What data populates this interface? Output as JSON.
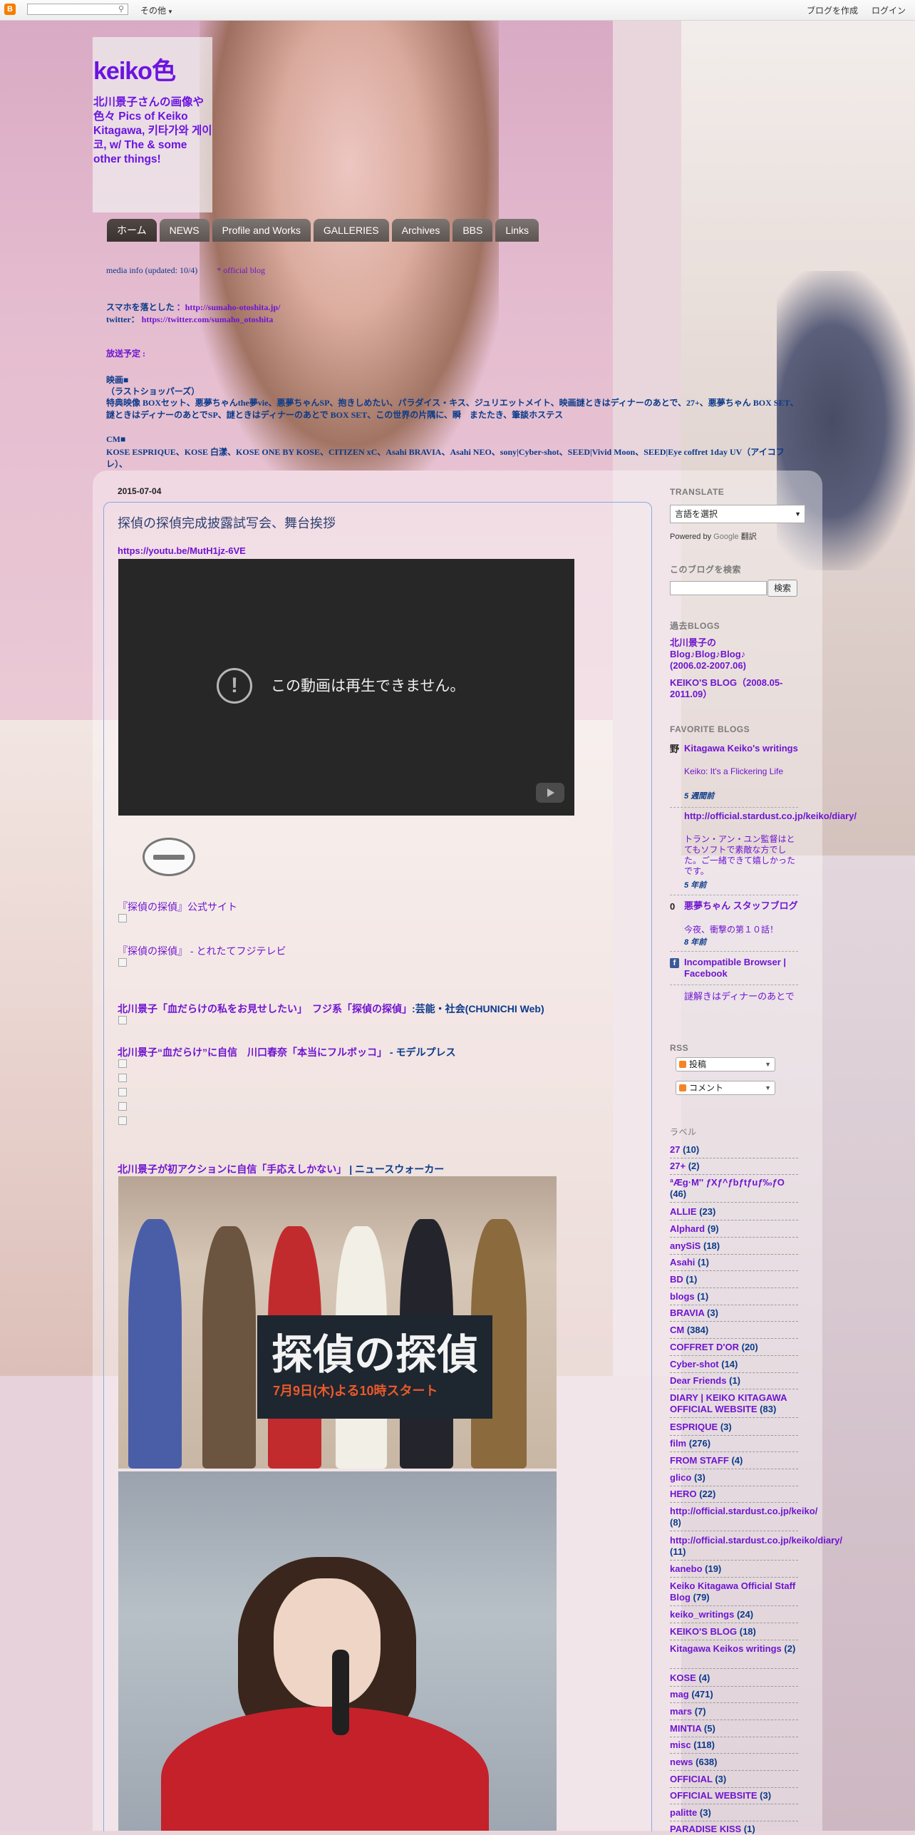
{
  "navbar": {
    "logo": "B",
    "more_label": "その他",
    "create_blog": "ブログを作成",
    "login": "ログイン"
  },
  "header": {
    "title": "keiko色",
    "description": "北川景子さんの画像や色々 Pics of Keiko Kitagawa, 키타가와 게이코, w/ The & some other things!",
    "tabs": [
      "ホーム",
      "NEWS",
      "Profile and Works",
      "GALLERIES",
      "Archives",
      "BBS",
      "Links"
    ],
    "line1_prefix": "media info (updated: 10/4)",
    "line1_link": "* official blog",
    "line2_label": "スマホを落とした",
    "line2_link": "：http://sumaho-otoshita.jp/",
    "line3_label": "twitter：",
    "line3_link": "https://twitter.com/sumaho_otoshita",
    "line4": "放送予定 :",
    "line5": "映画■",
    "line6": "（ラストショッパーズ）",
    "line7": "特典映像 BOXセット、悪夢ちゃんthe夢vie、悪夢ちゃんSP、抱きしめたい、パラダイス・キス、ジュリエットメイト、映画謎ときはディナーのあとで、27+、悪夢ちゃん BOX SET、謎ときはディナーのあとでSP、謎ときはディナーのあとで BOX SET、この世界の片隅に、瞬　またたき、筆談ホステス",
    "line8": "CM■",
    "line9": "KOSE ESPRIQUE、KOSE 白漾、KOSE ONE BY KOSE、CITIZEN xC、Asahi BRAVIA、Asahi NEO、sony|Cyber-shot、SEED|Vivid Moon、SEED|Eye coffret 1day UV（アイコフレ）、"
  },
  "post": {
    "date": "2015-07-04",
    "title": "探偵の探偵完成披露試写会、舞台挨拶",
    "youtube_link": "https://youtu.be/MutH1jz-6VE",
    "video_message": "この動画は再生できません。",
    "warn_icon": "!",
    "links": [
      {
        "text": "『探偵の探偵』公式サイト",
        "tail": ""
      },
      {
        "text": "『探偵の探偵』 - とれたてフジテレビ",
        "tail": ""
      },
      {
        "text": "北川景子「血だらけの私をお見せしたい」　フジ系「探偵の探偵」",
        "tail": ":芸能・社会(CHUNICHI Web)"
      },
      {
        "text": "北川景子“血だらけ”に自信　川口春奈「本当にフルボッコ」",
        "tail": " - モデルプレス"
      },
      {
        "text": "北川景子が初アクションに自信「手応えしかない」",
        "tail": " | ニュースウォーカー"
      }
    ],
    "photo1_banner_title": "探偵の探偵",
    "photo1_banner_sub": "7月9日(木)よる10時スタート"
  },
  "sidebar": {
    "translate_head": "TRANSLATE",
    "translate_select": "言語を選択",
    "powered_by": "Powered by",
    "google": "Google",
    "translate_word": "翻訳",
    "search_head": "このブログを検索",
    "search_button": "検索",
    "past_head": "過去BLOGS",
    "past_links": [
      "北川景子の Blog♪Blog♪Blog♪ (2006.02-2007.06)",
      "KEIKO'S BLOG（2008.05-2011.09）"
    ],
    "fav_head": "FAVORITE BLOGS",
    "favorites": [
      {
        "icon": "野",
        "title": "Kitagawa Keiko's writings",
        "sub": "Keiko: It's a Flickering Life",
        "ago": "5 週間前"
      },
      {
        "icon": "",
        "title": "http://official.stardust.co.jp/keiko/diary/",
        "sub": "トラン・アン・ユン監督はとてもソフトで素敵な方でした。ご一緒できて嬉しかったです。",
        "ago": "5 年前"
      },
      {
        "icon": "0",
        "title": "悪夢ちゃん スタッフブログ",
        "sub": "今夜、衝撃の第１０話！",
        "ago": "8 年前"
      },
      {
        "icon": "f",
        "title": "Incompatible Browser | Facebook",
        "sub": "",
        "ago": ""
      },
      {
        "icon": "",
        "title": "謎解きはディナーのあとで",
        "sub": "",
        "ago": ""
      }
    ],
    "rss_head": "RSS",
    "rss_posts": "投稿",
    "rss_comments": "コメント",
    "labels_head": "ラベル",
    "labels": [
      {
        "name": "27",
        "count": "(10)"
      },
      {
        "name": "27+",
        "count": "(2)"
      },
      {
        "name": "ªÆg·M'' ƒXƒ^ƒbƒtƒuƒ‰ƒO",
        "count": "(46)"
      },
      {
        "name": "ALLIE",
        "count": "(23)"
      },
      {
        "name": "Alphard",
        "count": "(9)"
      },
      {
        "name": "anySiS",
        "count": "(18)"
      },
      {
        "name": "Asahi",
        "count": "(1)"
      },
      {
        "name": "BD",
        "count": "(1)"
      },
      {
        "name": "blogs",
        "count": "(1)"
      },
      {
        "name": "BRAVIA",
        "count": "(3)"
      },
      {
        "name": "CM",
        "count": "(384)"
      },
      {
        "name": "COFFRET D'OR",
        "count": "(20)"
      },
      {
        "name": "Cyber-shot",
        "count": "(14)"
      },
      {
        "name": "Dear Friends",
        "count": "(1)"
      },
      {
        "name": "DIARY | KEIKO KITAGAWA OFFICIAL WEBSITE",
        "count": "(83)"
      },
      {
        "name": "ESPRIQUE",
        "count": "(3)"
      },
      {
        "name": "film",
        "count": "(276)"
      },
      {
        "name": "FROM STAFF",
        "count": "(4)"
      },
      {
        "name": "glico",
        "count": "(3)"
      },
      {
        "name": "HERO",
        "count": "(22)"
      },
      {
        "name": "http://official.stardust.co.jp/keiko/",
        "count": "(8)"
      },
      {
        "name": "http://official.stardust.co.jp/keiko/diary/",
        "count": "(11)"
      },
      {
        "name": "kanebo",
        "count": "(19)"
      },
      {
        "name": "Keiko Kitagawa Official Staff Blog",
        "count": "(79)"
      },
      {
        "name": "keiko_writings",
        "count": "(24)"
      },
      {
        "name": "KEIKO'S BLOG",
        "count": "(18)"
      },
      {
        "name": "Kitagawa Keikos writings",
        "count": "(2)"
      },
      {
        "name": "KOSE",
        "count": "(4)"
      },
      {
        "name": "mag",
        "count": "(471)"
      },
      {
        "name": "mars",
        "count": "(7)"
      },
      {
        "name": "MINTIA",
        "count": "(5)"
      },
      {
        "name": "misc",
        "count": "(118)"
      },
      {
        "name": "news",
        "count": "(638)"
      },
      {
        "name": "OFFICIAL",
        "count": "(3)"
      },
      {
        "name": "OFFICIAL WEBSITE",
        "count": "(3)"
      },
      {
        "name": "palitte",
        "count": "(3)"
      },
      {
        "name": "PARADISE KISS",
        "count": "(1)"
      }
    ]
  }
}
